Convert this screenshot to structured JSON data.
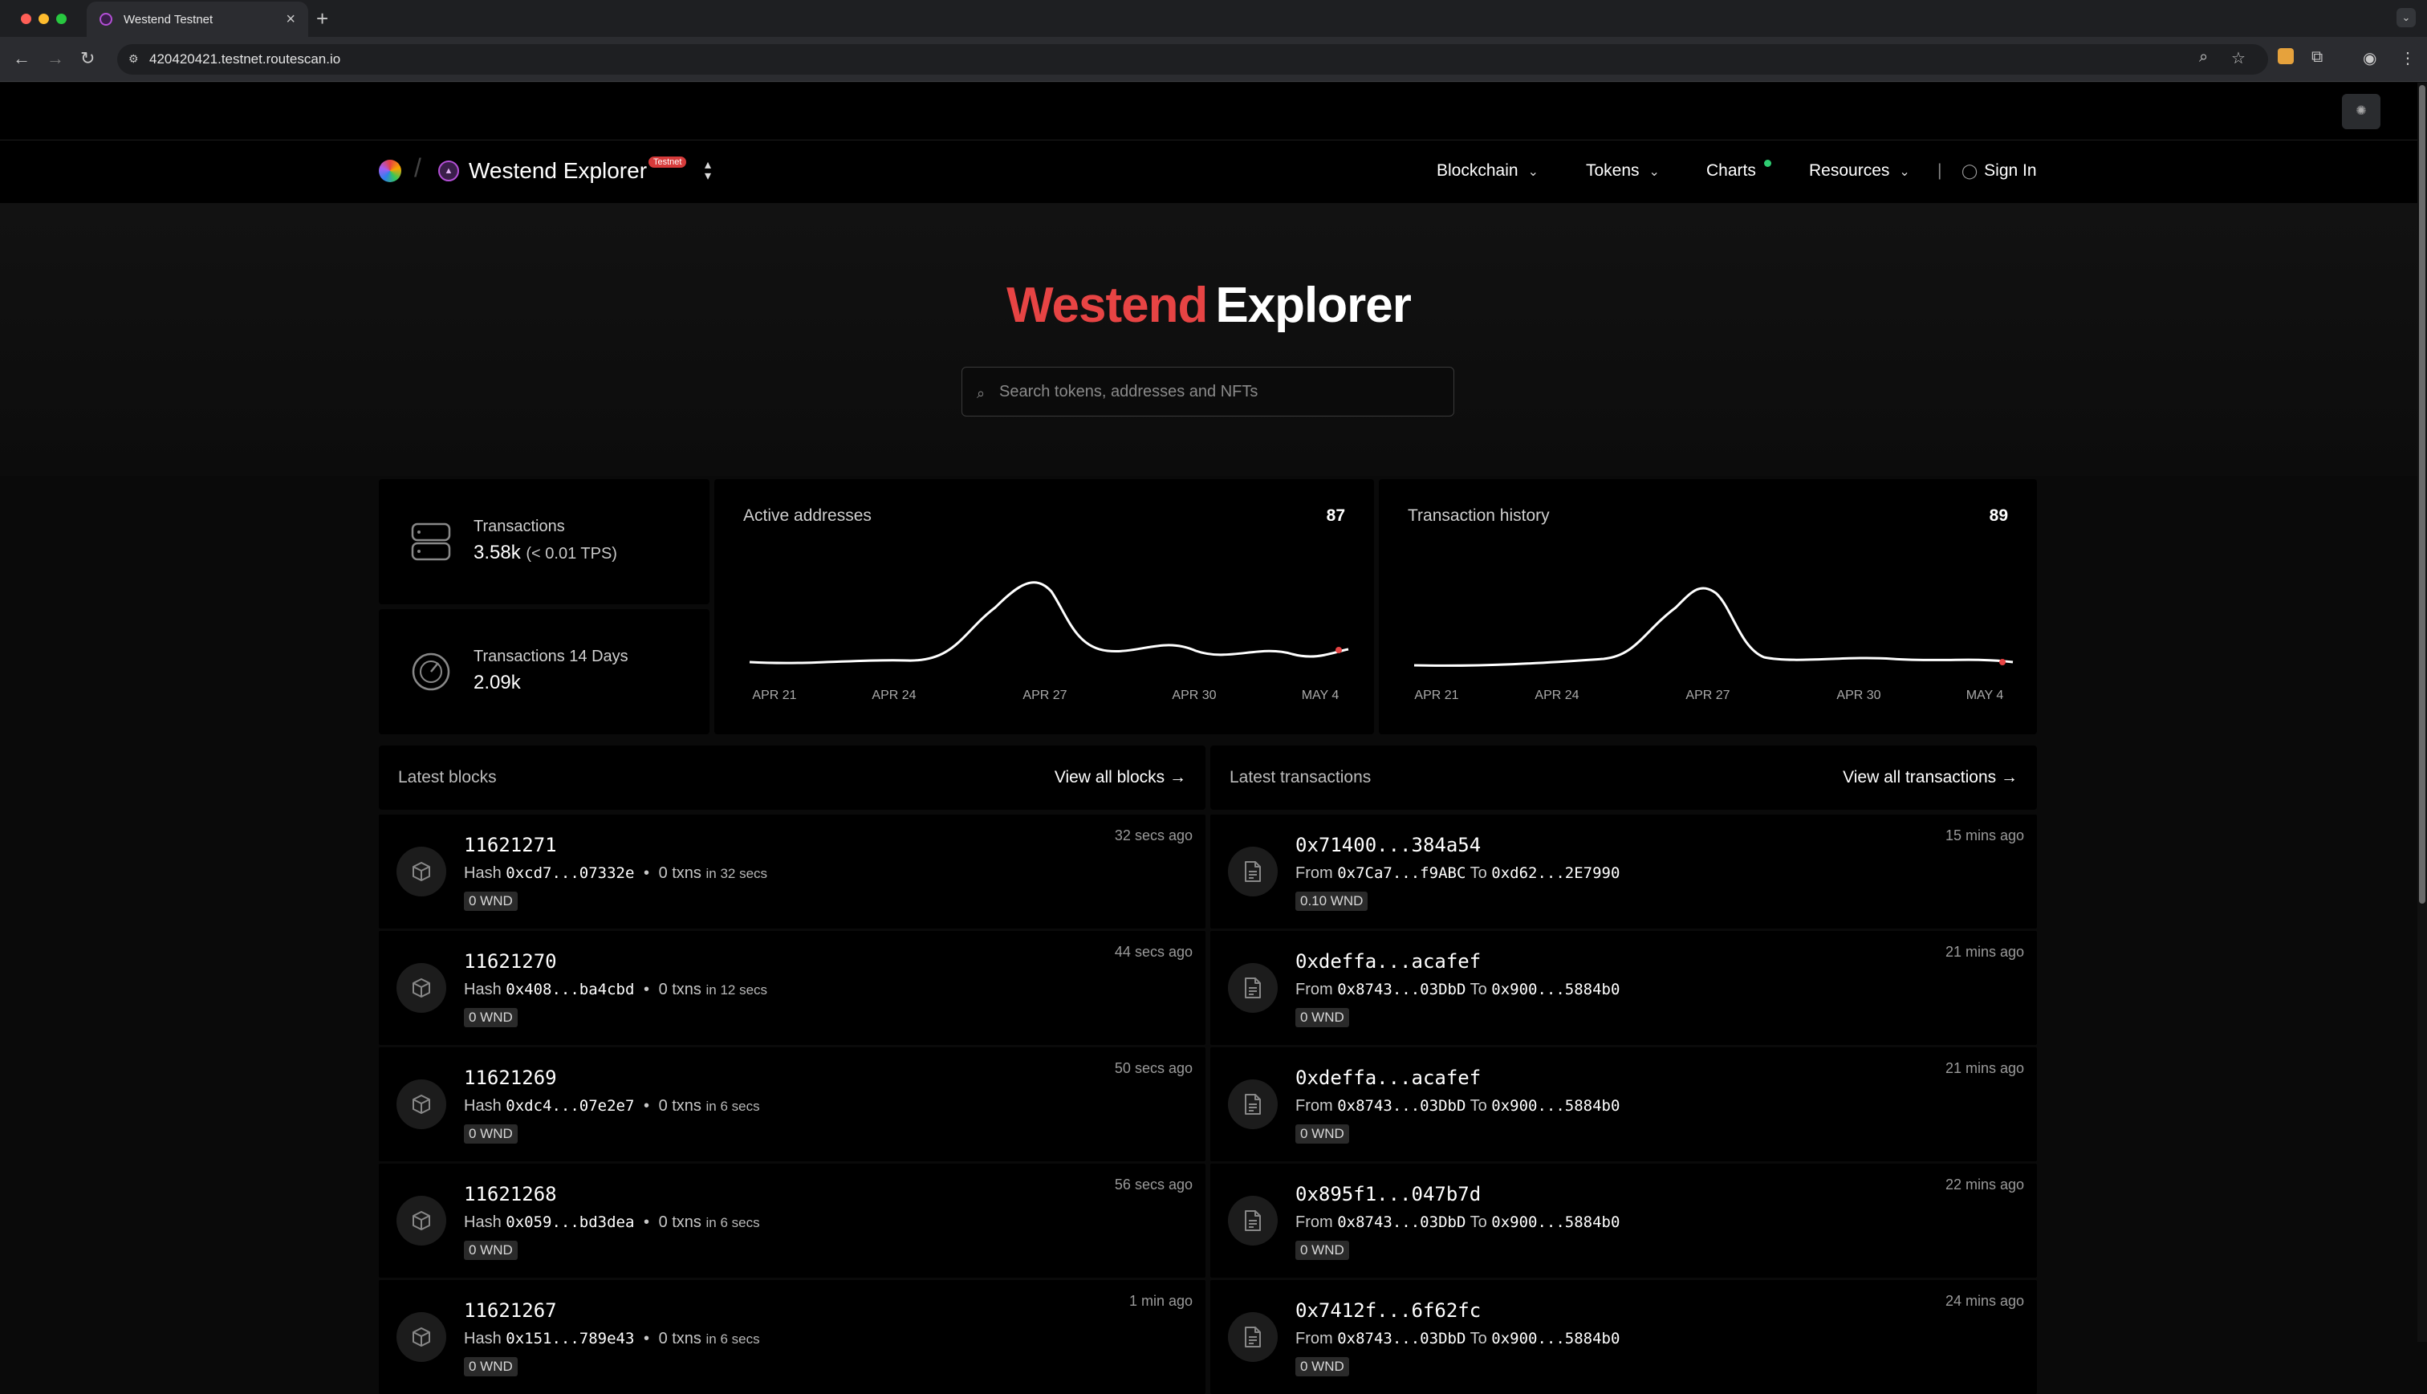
{
  "browser": {
    "tab_title": "Westend Testnet",
    "url": "420420421.testnet.routescan.io",
    "new_tab_symbol": "+",
    "tab_close_symbol": "×"
  },
  "header": {
    "brand": "Westend Explorer",
    "badge": "Testnet",
    "nav": {
      "blockchain": "Blockchain",
      "tokens": "Tokens",
      "charts": "Charts",
      "resources": "Resources",
      "separator": "|",
      "sign_in": "Sign In"
    }
  },
  "hero": {
    "title_red": "Westend",
    "title_white": "Explorer",
    "search_placeholder": "Search tokens, addresses and NFTs"
  },
  "stats": {
    "transactions_label": "Transactions",
    "transactions_value": "3.58k",
    "transactions_tps": "(< 0.01 TPS)",
    "tx14_label": "Transactions 14 Days",
    "tx14_value": "2.09k"
  },
  "charts": {
    "active": {
      "title": "Active addresses",
      "value": "87",
      "ticks": [
        "APR 21",
        "APR 24",
        "APR 27",
        "APR 30",
        "MAY 4"
      ]
    },
    "history": {
      "title": "Transaction history",
      "value": "89",
      "ticks": [
        "APR 21",
        "APR 24",
        "APR 27",
        "APR 30",
        "MAY 4"
      ]
    }
  },
  "blocks": {
    "title": "Latest blocks",
    "view_all": "View all blocks →",
    "rows": [
      {
        "number": "11621271",
        "hash_label": "Hash",
        "hash": "0xcd7...07332e",
        "txns": "0 txns",
        "duration": "in 32 secs",
        "reward": "0 WND",
        "age": "32 secs ago"
      },
      {
        "number": "11621270",
        "hash_label": "Hash",
        "hash": "0x408...ba4cbd",
        "txns": "0 txns",
        "duration": "in 12 secs",
        "reward": "0 WND",
        "age": "44 secs ago"
      },
      {
        "number": "11621269",
        "hash_label": "Hash",
        "hash": "0xdc4...07e2e7",
        "txns": "0 txns",
        "duration": "in 6 secs",
        "reward": "0 WND",
        "age": "50 secs ago"
      },
      {
        "number": "11621268",
        "hash_label": "Hash",
        "hash": "0x059...bd3dea",
        "txns": "0 txns",
        "duration": "in 6 secs",
        "reward": "0 WND",
        "age": "56 secs ago"
      },
      {
        "number": "11621267",
        "hash_label": "Hash",
        "hash": "0x151...789e43",
        "txns": "0 txns",
        "duration": "in 6 secs",
        "reward": "0 WND",
        "age": "1 min ago"
      }
    ]
  },
  "transactions": {
    "title": "Latest transactions",
    "view_all": "View all transactions →",
    "rows": [
      {
        "hash": "0x71400...384a54",
        "from_label": "From",
        "from": "0x7Ca7...f9ABC",
        "to_label": "To",
        "to": "0xd62...2E7990",
        "value": "0.10 WND",
        "age": "15 mins ago"
      },
      {
        "hash": "0xdeffa...acafef",
        "from_label": "From",
        "from": "0x8743...03DbD",
        "to_label": "To",
        "to": "0x900...5884b0",
        "value": "0 WND",
        "age": "21 mins ago"
      },
      {
        "hash": "0xdeffa...acafef",
        "from_label": "From",
        "from": "0x8743...03DbD",
        "to_label": "To",
        "to": "0x900...5884b0",
        "value": "0 WND",
        "age": "21 mins ago"
      },
      {
        "hash": "0x895f1...047b7d",
        "from_label": "From",
        "from": "0x8743...03DbD",
        "to_label": "To",
        "to": "0x900...5884b0",
        "value": "0 WND",
        "age": "22 mins ago"
      },
      {
        "hash": "0x7412f...6f62fc",
        "from_label": "From",
        "from": "0x8743...03DbD",
        "to_label": "To",
        "to": "0x900...5884b0",
        "value": "0 WND",
        "age": "24 mins ago"
      }
    ]
  }
}
